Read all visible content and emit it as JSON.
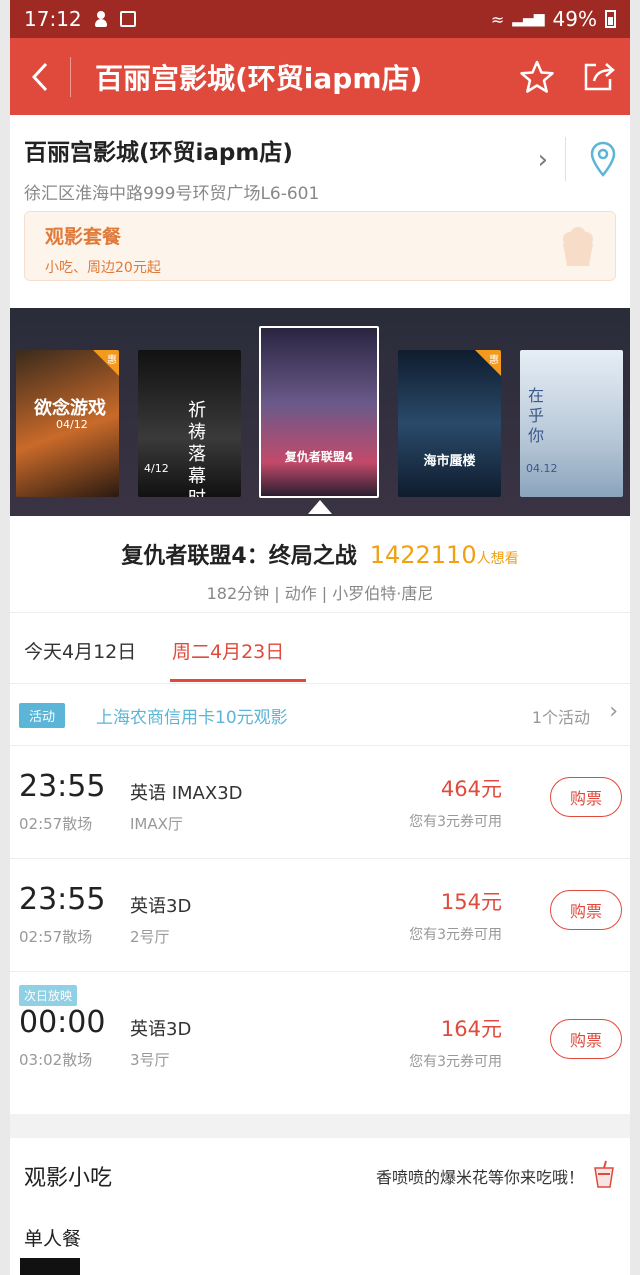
{
  "status_bar": {
    "time": "17:12",
    "battery": "49%"
  },
  "nav": {
    "title": "百丽宫影城(环贸iapm店)",
    "back_icon": "chevron-left-icon",
    "favorite_icon": "star-icon",
    "share_icon": "share-icon"
  },
  "cinema": {
    "name": "百丽宫影城(环贸iapm店)",
    "address": "徐汇区淮海中路999号环贸广场L6-601"
  },
  "combo": {
    "title": "观影套餐",
    "subtitle": "小吃、周边20元起"
  },
  "posters": [
    {
      "title": "欲念游戏",
      "date": "04/12",
      "tag": "惠",
      "colors": [
        "#3a2a1c",
        "#c96a2a"
      ]
    },
    {
      "title": "祈祷落幕时",
      "date": "4/12",
      "tag": "",
      "colors": [
        "#1a1a1a",
        "#4a4a4a"
      ]
    },
    {
      "title": "复仇者联盟4",
      "date": "",
      "tag": "",
      "colors": [
        "#3a2f5a",
        "#6a5a8a"
      ],
      "selected": true
    },
    {
      "title": "海市蜃楼",
      "date": "",
      "tag": "惠",
      "colors": [
        "#0f1c2e",
        "#3a5a7a"
      ]
    },
    {
      "title": "在乎你",
      "date": "04.12",
      "tag": "",
      "colors": [
        "#cfdbe6",
        "#8aa4bc"
      ]
    }
  ],
  "movie": {
    "title": "复仇者联盟4：终局之战",
    "want_count": "1422110",
    "want_label": "人想看",
    "meta": "182分钟 | 动作 | 小罗伯特·唐尼"
  },
  "tabs": [
    {
      "label": "今天4月12日",
      "active": false
    },
    {
      "label": "周二4月23日",
      "active": true
    }
  ],
  "promo": {
    "badge": "活动",
    "text": "上海农商信用卡10元观影",
    "count": "1个活动"
  },
  "showtimes": [
    {
      "time": "23:55",
      "end": "02:57散场",
      "lang": "英语 IMAX3D",
      "hall": "IMAX厅",
      "price": "464元",
      "coupon": "您有3元券可用",
      "buy": "购票",
      "next_day": ""
    },
    {
      "time": "23:55",
      "end": "02:57散场",
      "lang": "英语3D",
      "hall": "2号厅",
      "price": "154元",
      "coupon": "您有3元券可用",
      "buy": "购票",
      "next_day": ""
    },
    {
      "time": "00:00",
      "end": "03:02散场",
      "lang": "英语3D",
      "hall": "3号厅",
      "price": "164元",
      "coupon": "您有3元券可用",
      "buy": "购票",
      "next_day": "次日放映"
    }
  ],
  "snacks": {
    "title": "观影小吃",
    "tip": "香喷喷的爆米花等你来吃哦！",
    "section": "单人餐"
  },
  "colors": {
    "brand": "#e04a3c",
    "accent_orange": "#f0a012",
    "promo_blue": "#5bb5d6"
  }
}
